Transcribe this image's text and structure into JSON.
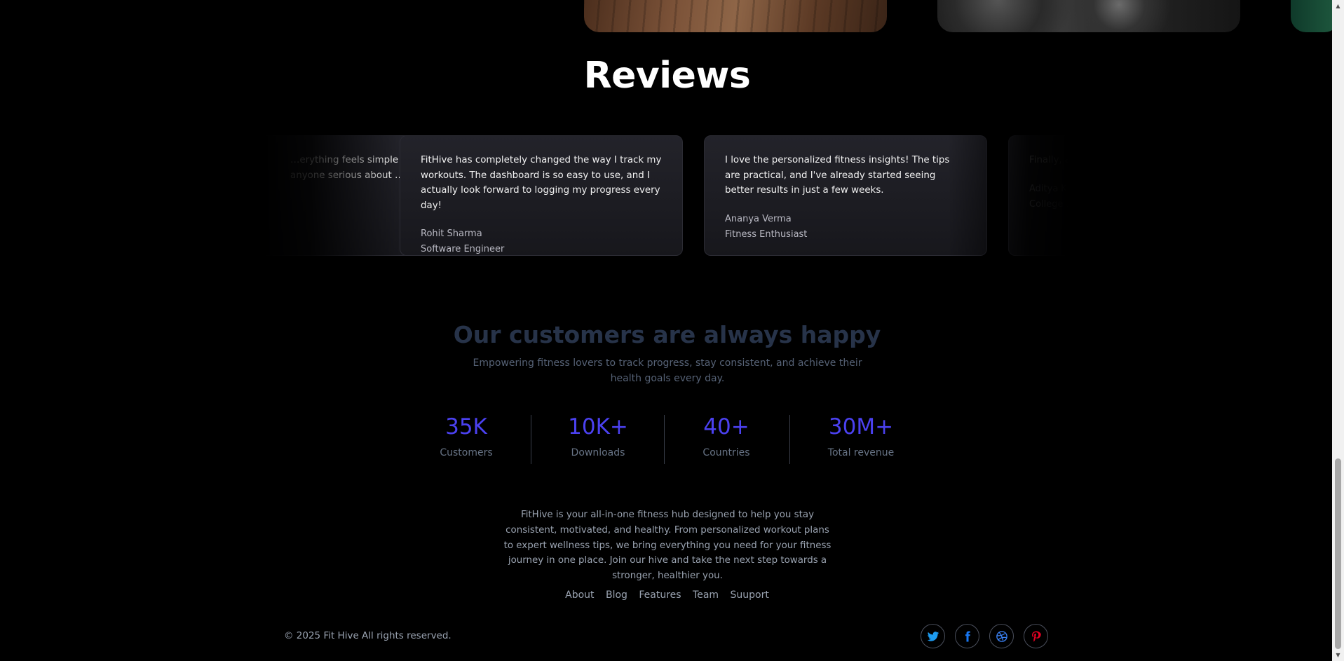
{
  "reviews": {
    "title": "Reviews",
    "items": [
      {
        "text": "…erything feels simple … anyone serious about …",
        "name": "",
        "role": ""
      },
      {
        "text": "FitHive has completely changed the way I track my workouts. The dashboard is so easy to use, and I actually look forward to logging my progress every day!",
        "name": "Rohit Sharma",
        "role": "Software Engineer"
      },
      {
        "text": "I love the personalized fitness insights! The tips are practical, and I've already started seeing better results in just a few weeks.",
        "name": "Ananya Verma",
        "role": "Fitness Enthusiast"
      },
      {
        "text": "Finally, an … progress t…",
        "name": "Aditya K…",
        "role": "College …"
      }
    ]
  },
  "stats": {
    "heading": "Our customers are always happy",
    "subtitle": "Empowering fitness lovers to track progress, stay consistent, and achieve their health goals every day.",
    "items": [
      {
        "value": "35K",
        "label": "Customers"
      },
      {
        "value": "10K+",
        "label": "Downloads"
      },
      {
        "value": "40+",
        "label": "Countries"
      },
      {
        "value": "30M+",
        "label": "Total revenue"
      }
    ]
  },
  "footer": {
    "about": "FitHive is your all-in-one fitness hub designed to help you stay consistent, motivated, and healthy. From personalized workout plans to expert wellness tips, we bring everything you need for your fitness journey in one place. Join our hive and take the next step towards a stronger, healthier you.",
    "links": [
      "About",
      "Blog",
      "Features",
      "Team",
      "Suuport"
    ],
    "copyright": "© 2025 Fit Hive All rights reserved.",
    "socials": [
      {
        "icon": "twitter-icon",
        "color": "#1d9bf0"
      },
      {
        "icon": "facebook-icon",
        "color": "#1877f2"
      },
      {
        "icon": "dribbble-icon",
        "color": "#3b82f6"
      },
      {
        "icon": "pinterest-icon",
        "color": "#e60023"
      }
    ]
  },
  "colors": {
    "accent": "#4b41f0",
    "heading_muted": "#273349",
    "background": "#000000"
  }
}
